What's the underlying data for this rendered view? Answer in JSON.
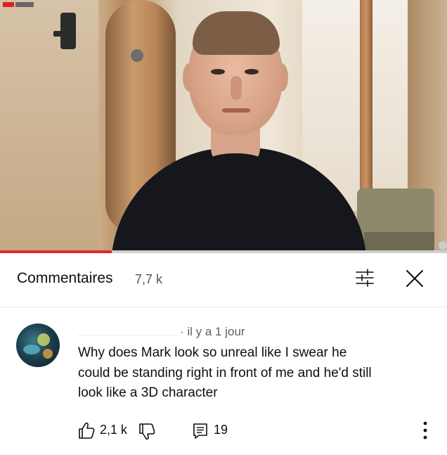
{
  "video": {
    "progress_fraction": 0.25,
    "accent_color": "#e02828"
  },
  "comments_header": {
    "title": "Commentaires",
    "count": "7,7 k",
    "sort_icon": "sort-icon",
    "close_icon": "close-icon"
  },
  "comment": {
    "avatar_icon": "avatar",
    "time": "· il y a 1 jour",
    "lines": [
      "Why does Mark look so unreal like I swear he",
      "could be standing right in front of me and he'd still",
      "look like a 3D character"
    ],
    "likes": "2,1 k",
    "replies": "19",
    "like_icon": "thumbs-up-icon",
    "dislike_icon": "thumbs-down-icon",
    "reply_icon": "reply-icon",
    "more_icon": "more-vertical-icon"
  }
}
